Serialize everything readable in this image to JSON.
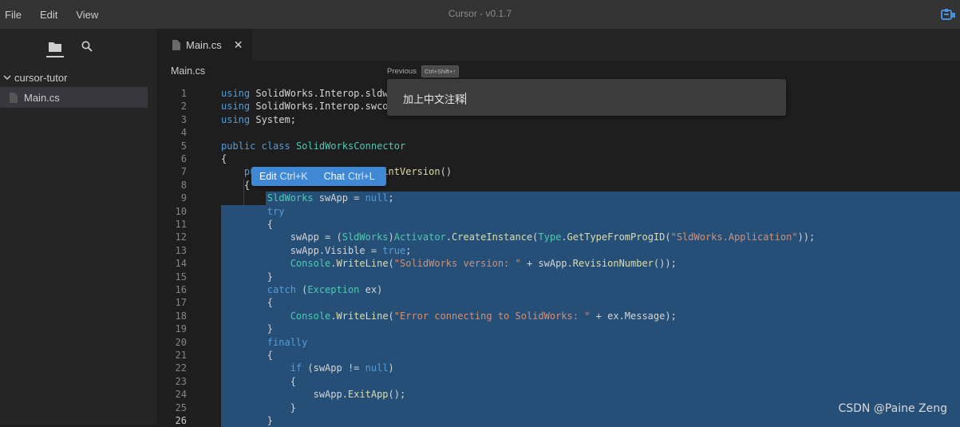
{
  "menu": {
    "file": "File",
    "edit": "Edit",
    "view": "View"
  },
  "app_title": "Cursor - v0.1.7",
  "sidebar": {
    "folder": "cursor-tutor",
    "file": "Main.cs"
  },
  "tab": {
    "label": "Main.cs",
    "close": "✕"
  },
  "breadcrumb": "Main.cs",
  "prompt": {
    "previous_label": "Previous",
    "previous_shortcut": "Ctrl+Shift+↑",
    "text": "加上中文注释"
  },
  "inline_popup": {
    "edit_label": "Edit",
    "edit_shortcut": "Ctrl+K",
    "chat_label": "Chat",
    "chat_shortcut": "Ctrl+L"
  },
  "editor": {
    "active_line": 26,
    "line_numbers": [
      "1",
      "2",
      "3",
      "4",
      "5",
      "6",
      "7",
      "8",
      "9",
      "10",
      "11",
      "12",
      "13",
      "14",
      "15",
      "16",
      "17",
      "18",
      "19",
      "20",
      "21",
      "22",
      "23",
      "24",
      "25",
      "26"
    ],
    "lines": [
      "using SolidWorks.Interop.sldworks;",
      "using SolidWorks.Interop.swconst;",
      "using System;",
      "",
      "public class SolidWorksConnector",
      "{",
      "    public void ConnectAndPrintVersion()",
      "    {",
      "        SldWorks swApp = null;",
      "        try",
      "        {",
      "            swApp = (SldWorks)Activator.CreateInstance(Type.GetTypeFromProgID(\"SldWorks.Application\"));",
      "            swApp.Visible = true;",
      "            Console.WriteLine(\"SolidWorks version: \" + swApp.RevisionNumber());",
      "        }",
      "        catch (Exception ex)",
      "        {",
      "            Console.WriteLine(\"Error connecting to SolidWorks: \" + ex.Message);",
      "        }",
      "        finally",
      "        {",
      "            if (swApp != null)",
      "            {",
      "                swApp.ExitApp();",
      "            }",
      "        }"
    ]
  },
  "watermark": "CSDN @Paine Zeng",
  "colors": {
    "selection": "#264f78",
    "keyword": "#569cd6",
    "type": "#4ec9b0",
    "string": "#ce9178",
    "method": "#dcdcaa",
    "popup": "#3e88d6"
  }
}
